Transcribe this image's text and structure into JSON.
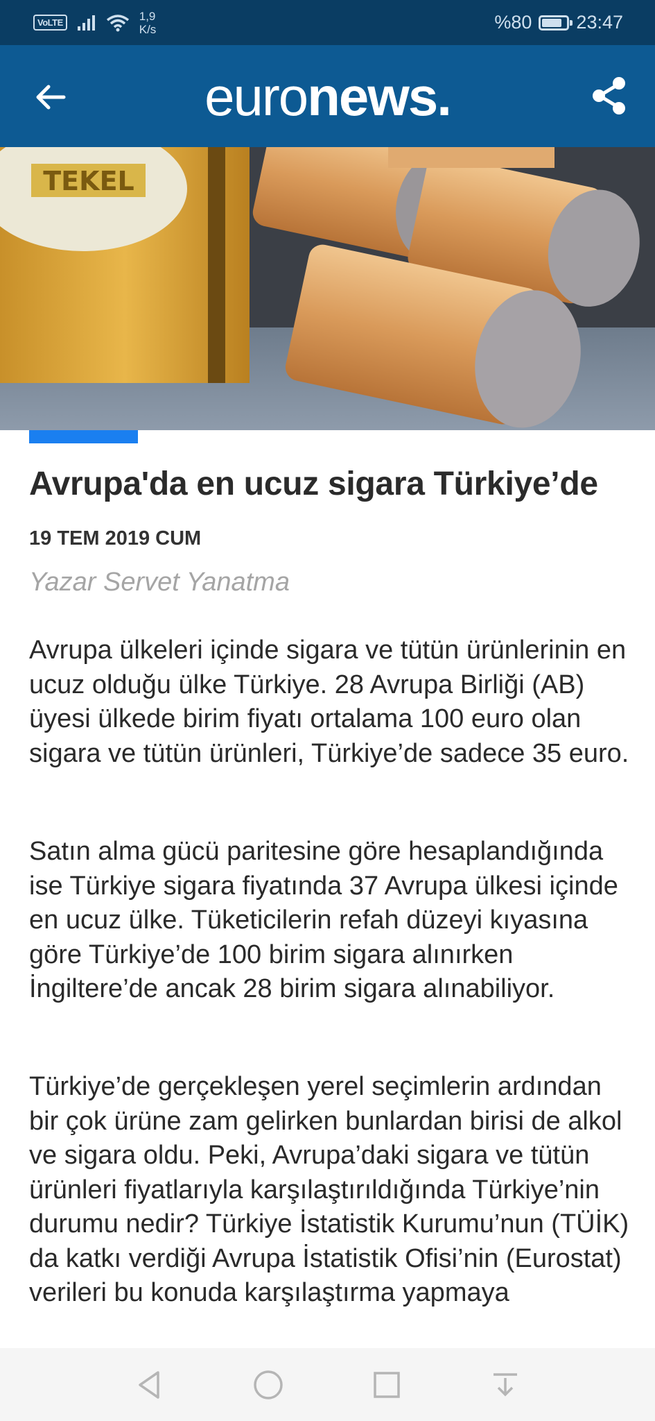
{
  "status_bar": {
    "volte": "VoLTE",
    "speed_value": "1,9",
    "speed_unit": "K/s",
    "battery_text": "%80",
    "battery_level": 0.8,
    "time": "23:47"
  },
  "app_bar": {
    "logo_light": "euro",
    "logo_bold": "news.",
    "back_icon": "arrow-left-icon",
    "share_icon": "share-icon"
  },
  "hero_image": {
    "brand_text": "TEKEL"
  },
  "article": {
    "title": "Avrupa'da en ucuz sigara Türkiye’de",
    "date": "19 TEM 2019 CUM",
    "author": "Yazar Servet Yanatma",
    "paragraphs": [
      "Avrupa ülkeleri içinde sigara ve tütün ürünlerinin en ucuz olduğu ülke Türkiye. 28 Avrupa Birliği (AB) üyesi ülkede birim fiyatı ortalama 100 euro olan sigara ve tütün ürünleri, Türkiye’de sadece 35 euro.",
      "Satın alma gücü paritesine göre hesaplandığında ise Türkiye sigara fiyatında 37 Avrupa ülkesi içinde en ucuz ülke. Tüketicilerin refah düzeyi kıyasına göre Türkiye’de 100 birim sigara alınırken İngiltere’de ancak 28 birim sigara alınabiliyor.",
      "Türkiye’de gerçekleşen yerel seçimlerin ardından bir çok ürüne zam gelirken bunlardan birisi de alkol ve sigara oldu. Peki, Avrupa’daki sigara ve tütün ürünleri fiyatlarıyla karşılaştırıldığında Türkiye’nin durumu nedir? Türkiye İstatistik Kurumu’nun (TÜİK) da katkı verdiği Avrupa İstatistik Ofisi’nin (Eurostat) verileri bu konuda karşılaştırma yapmaya"
    ]
  },
  "colors": {
    "status_bar": "#0a3d63",
    "app_bar": "#0d5a93",
    "accent": "#1a7ff0"
  },
  "nav_bar": {
    "icons": [
      "back-triangle-icon",
      "home-circle-icon",
      "recents-square-icon",
      "notification-pull-icon"
    ]
  }
}
